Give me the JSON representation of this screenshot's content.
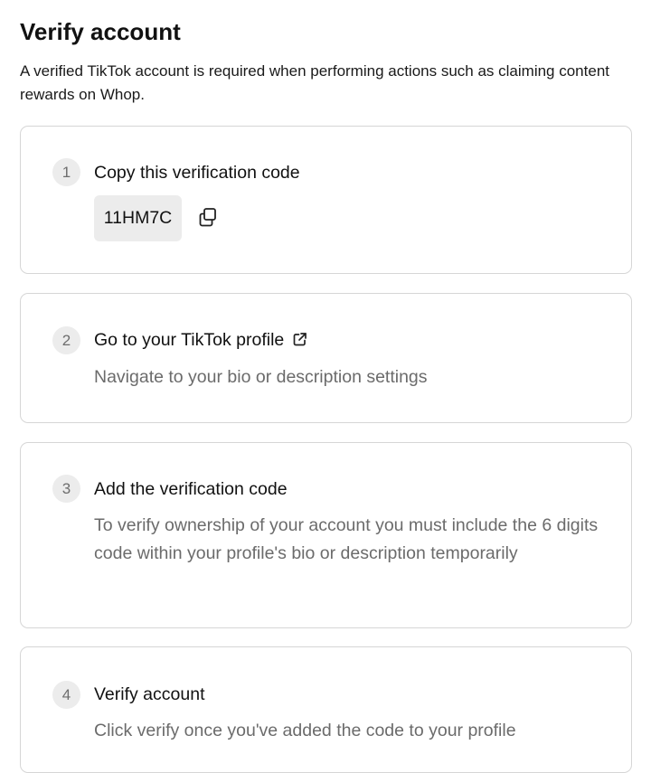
{
  "header": {
    "title": "Verify account",
    "description": "A verified TikTok account is required when performing actions such as claiming content rewards on Whop."
  },
  "steps": [
    {
      "number": "1",
      "title": "Copy this verification code",
      "code": "11HM7C",
      "icon": "copy-icon"
    },
    {
      "number": "2",
      "title": "Go to your TikTok profile",
      "icon": "external-link-icon",
      "description": "Navigate to your bio or description settings"
    },
    {
      "number": "3",
      "title": "Add the verification code",
      "description": "To verify ownership of your account you must include the 6 digits code within your profile's bio or description temporarily"
    },
    {
      "number": "4",
      "title": "Verify account",
      "description": "Click verify once you've added the code to your profile"
    }
  ]
}
